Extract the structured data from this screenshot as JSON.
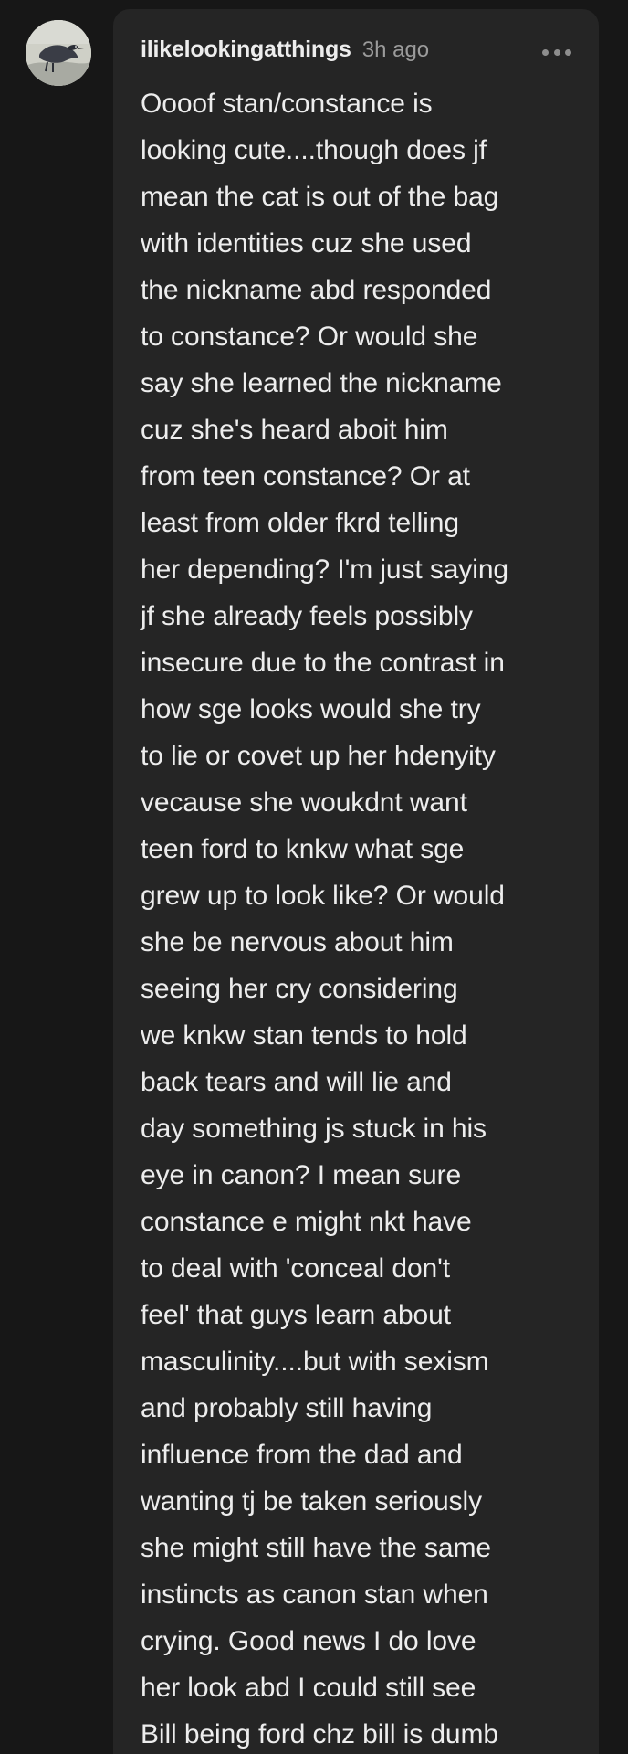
{
  "comment": {
    "username": "ilikelookingatthings",
    "timestamp": "3h ago",
    "icons": {
      "avatar": "crow-avatar",
      "more": "more-horizontal-icon"
    },
    "body_lines": [
      "Oooof stan/constance is",
      "looking cute....though does jf",
      "mean the cat is out of the bag",
      "with identities cuz she used",
      "the nickname abd responded",
      "to constance? Or would she",
      "say she learned the nickname",
      "cuz she's heard aboit him",
      "from teen constance? Or at",
      "least from older fkrd telling",
      "her depending? I'm just saying",
      "jf she already feels possibly",
      "insecure due to the contrast in",
      "how sge looks would she try",
      "to lie or covet up her hdenyity",
      "vecause she woukdnt want",
      "teen ford to knkw what sge",
      "grew up to look like? Or would",
      "she be nervous about him",
      "seeing her cry considering",
      "we knkw stan tends to hold",
      "back tears and will lie and",
      "day something js stuck in his",
      "eye in canon? I mean sure",
      "constance e might nkt have",
      "to deal with 'conceal don't",
      "feel' that guys learn about",
      "masculinity....but with sexism",
      "and probably still having",
      "influence from the dad and",
      "wanting tj be taken seriously",
      "she might still have the same",
      "instincts as canon stan when",
      "crying. Good news I do love",
      "her look abd I could still see",
      "Bill being ford chz bill is dumb"
    ]
  },
  "colors": {
    "background": "#171717",
    "bubble": "#252525",
    "text": "#ededed",
    "muted": "#9b9b9b"
  }
}
